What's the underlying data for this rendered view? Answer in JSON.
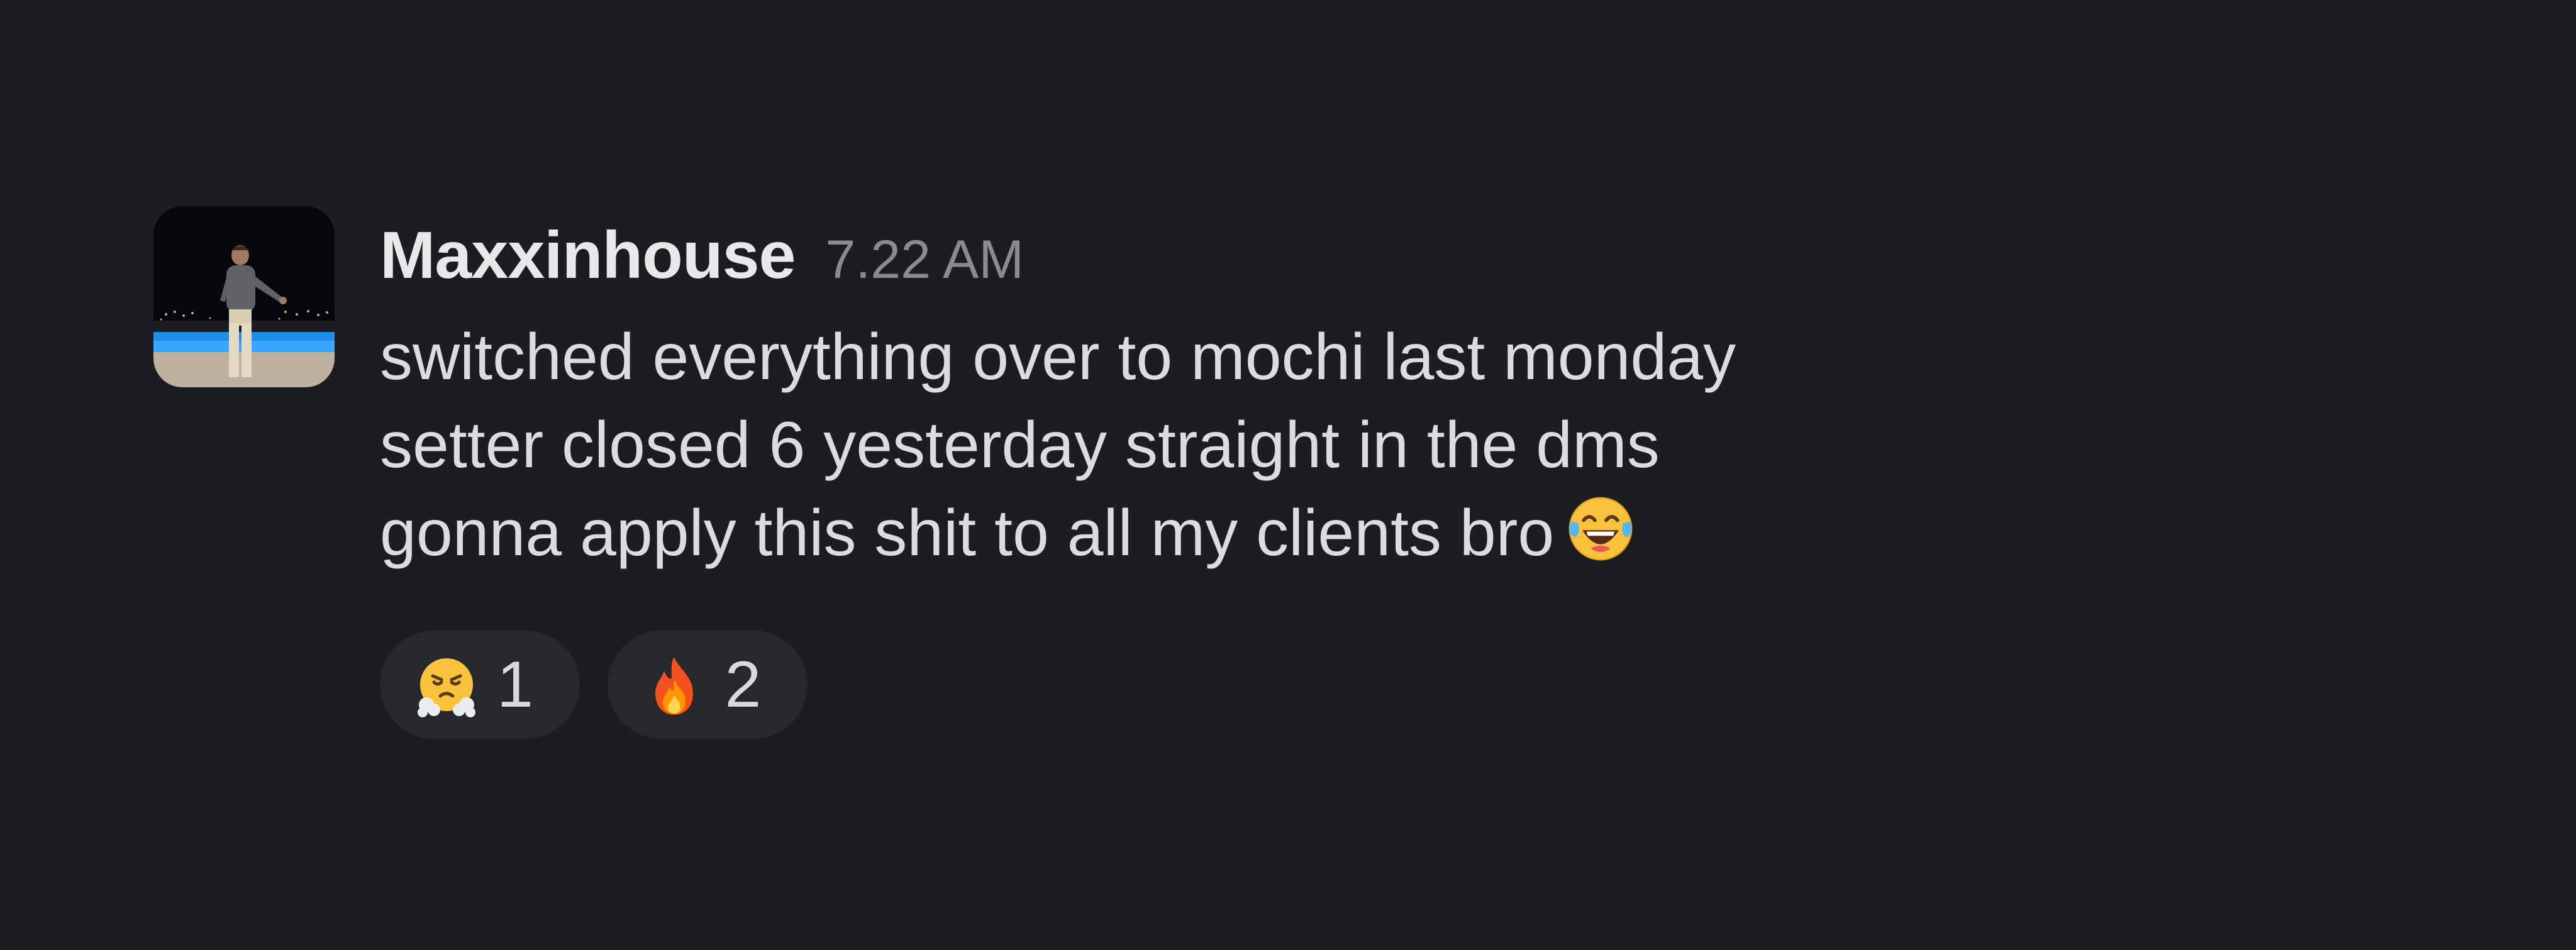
{
  "message": {
    "author": "Maxxinhouse",
    "timestamp": "7.22 AM",
    "avatar_icon": "avatar-photo-icon",
    "lines": [
      "switched everything over to mochi last monday",
      "setter closed 6 yesterday straight in the dms",
      "gonna apply this shit to all my clients bro"
    ],
    "trailing_emoji": "face-with-tears-of-joy-icon"
  },
  "reactions": [
    {
      "emoji": "face-with-steam-from-nose-icon",
      "count": "1"
    },
    {
      "emoji": "fire-icon",
      "count": "2"
    }
  ],
  "colors": {
    "background": "#1c1d21",
    "text": "#dcdcdf",
    "timestamp": "#8a8b8f",
    "reaction_pill": "#27282d"
  }
}
